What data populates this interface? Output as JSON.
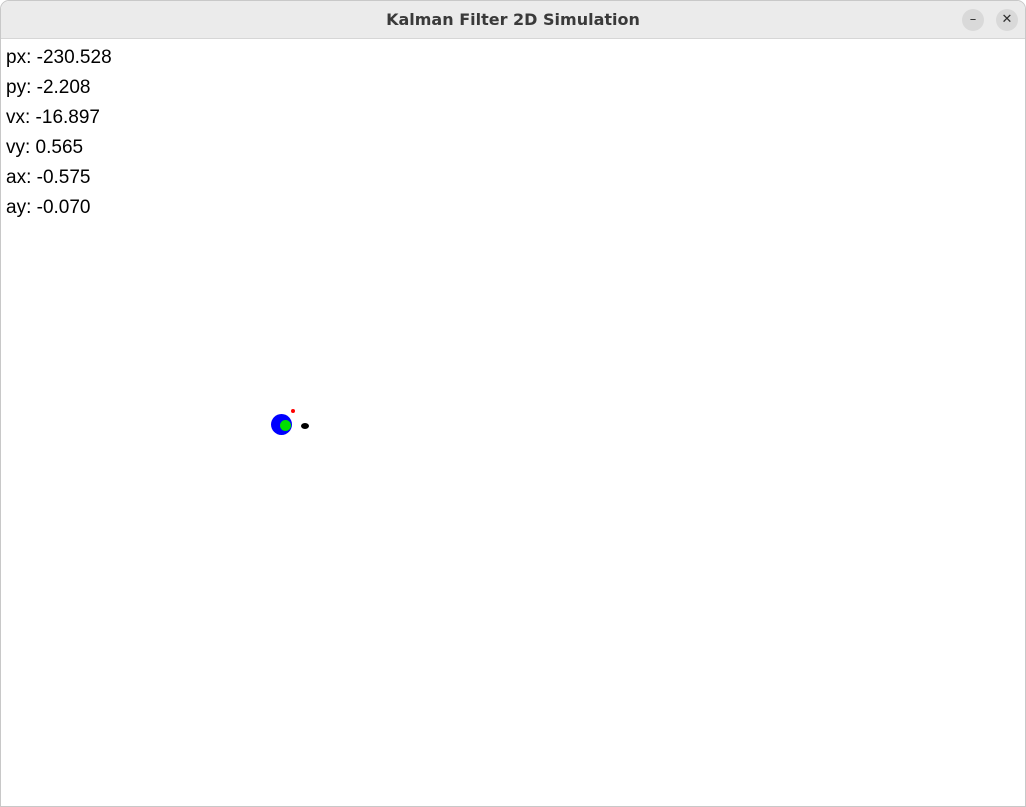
{
  "window": {
    "title": "Kalman Filter 2D Simulation",
    "minimize_glyph": "–",
    "close_glyph": "✕"
  },
  "readouts": [
    {
      "label": "px",
      "text": "px: -230.528"
    },
    {
      "label": "py",
      "text": "py: -2.208"
    },
    {
      "label": "vx",
      "text": "vx: -16.897"
    },
    {
      "label": "vy",
      "text": "vy: 0.565"
    },
    {
      "label": "ax",
      "text": "ax: -0.575"
    },
    {
      "label": "ay",
      "text": "ay: -0.070"
    }
  ],
  "markers": {
    "estimate_uncertainty_color": "#0000ff",
    "estimate_color": "#00e000",
    "measurement_color": "#ff0000",
    "true_position_color": "#000000"
  }
}
